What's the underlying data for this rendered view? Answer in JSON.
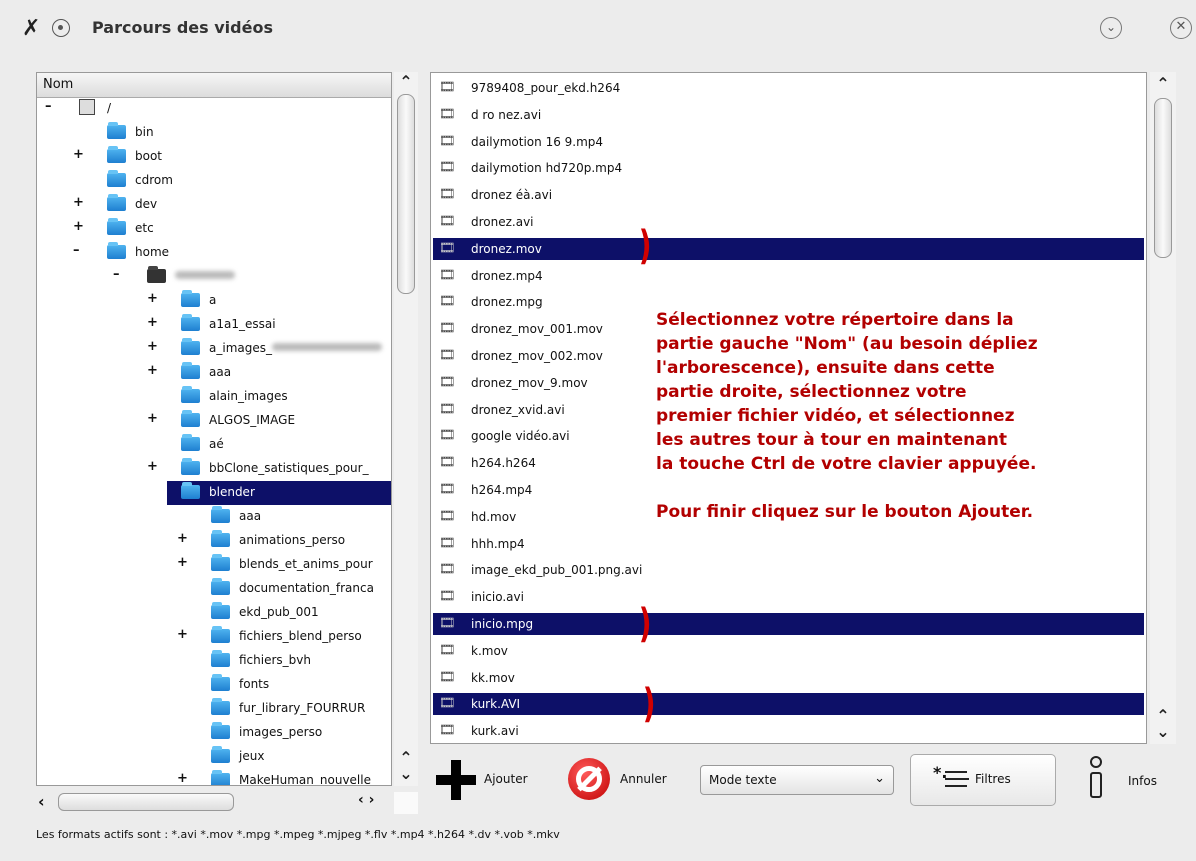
{
  "window": {
    "title": "Parcours des vidéos",
    "app_icon": "tools-icon"
  },
  "tree": {
    "header": "Nom",
    "rows": [
      {
        "label": "/",
        "type": "drive",
        "exp": "-",
        "indent": 0
      },
      {
        "label": "bin",
        "exp": "",
        "indent": 1
      },
      {
        "label": "boot",
        "exp": "+",
        "indent": 1
      },
      {
        "label": "cdrom",
        "exp": "",
        "indent": 1
      },
      {
        "label": "dev",
        "exp": "+",
        "indent": 1
      },
      {
        "label": "etc",
        "exp": "+",
        "indent": 1
      },
      {
        "label": "home",
        "exp": "-",
        "indent": 1
      },
      {
        "label": "",
        "type": "dark",
        "exp": "-",
        "indent": 2,
        "blur": 60
      },
      {
        "label": "a",
        "exp": "+",
        "indent": 3
      },
      {
        "label": "a1a1_essai",
        "exp": "+",
        "indent": 3
      },
      {
        "label": "a_images_",
        "exp": "+",
        "indent": 3,
        "blur": 110
      },
      {
        "label": "aaa",
        "exp": "+",
        "indent": 3
      },
      {
        "label": "alain_images",
        "exp": "",
        "indent": 3
      },
      {
        "label": "ALGOS_IMAGE",
        "exp": "+",
        "indent": 3
      },
      {
        "label": "aé",
        "exp": "",
        "indent": 3
      },
      {
        "label": "bbClone_satistiques_pour_",
        "exp": "+",
        "indent": 3
      },
      {
        "label": "blender",
        "exp": "-",
        "indent": 3,
        "selected": true
      },
      {
        "label": "aaa",
        "exp": "",
        "indent": 4
      },
      {
        "label": "animations_perso",
        "exp": "+",
        "indent": 4
      },
      {
        "label": "blends_et_anims_pour",
        "exp": "+",
        "indent": 4
      },
      {
        "label": "documentation_franca",
        "exp": "",
        "indent": 4
      },
      {
        "label": "ekd_pub_001",
        "exp": "",
        "indent": 4
      },
      {
        "label": "fichiers_blend_perso",
        "exp": "+",
        "indent": 4
      },
      {
        "label": "fichiers_bvh",
        "exp": "",
        "indent": 4
      },
      {
        "label": "fonts",
        "exp": "",
        "indent": 4
      },
      {
        "label": "fur_library_FOURRUR",
        "exp": "",
        "indent": 4
      },
      {
        "label": "images_perso",
        "exp": "",
        "indent": 4
      },
      {
        "label": "jeux",
        "exp": "",
        "indent": 4
      },
      {
        "label": "MakeHuman_nouvelle",
        "exp": "+",
        "indent": 4
      }
    ]
  },
  "files": [
    {
      "name": "9789408_pour_ekd.h264"
    },
    {
      "name": "d ro nez.avi"
    },
    {
      "name": "dailymotion 16 9.mp4"
    },
    {
      "name": "dailymotion hd720p.mp4"
    },
    {
      "name": "dronez éà.avi"
    },
    {
      "name": "dronez.avi"
    },
    {
      "name": "dronez.mov",
      "selected": true
    },
    {
      "name": "dronez.mp4"
    },
    {
      "name": "dronez.mpg"
    },
    {
      "name": "dronez_mov_001.mov"
    },
    {
      "name": "dronez_mov_002.mov"
    },
    {
      "name": "dronez_mov_9.mov"
    },
    {
      "name": "dronez_xvid.avi"
    },
    {
      "name": "google vidéo.avi"
    },
    {
      "name": "h264.h264"
    },
    {
      "name": "h264.mp4"
    },
    {
      "name": "hd.mov"
    },
    {
      "name": "hhh.mp4"
    },
    {
      "name": "image_ekd_pub_001.png.avi"
    },
    {
      "name": "inicio.avi"
    },
    {
      "name": "inicio.mpg",
      "selected": true
    },
    {
      "name": "k.mov"
    },
    {
      "name": "kk.mov"
    },
    {
      "name": "kurk.AVI",
      "selected": true
    },
    {
      "name": "kurk.avi"
    }
  ],
  "instructions": {
    "lines": [
      "Sélectionnez votre répertoire dans la",
      "partie gauche \"Nom\" (au besoin dépliez",
      "l'arborescence), ensuite dans cette",
      "partie droite, sélectionnez votre",
      "premier fichier vidéo, et sélectionnez",
      "les autres tour à tour en maintenant",
      "la touche Ctrl de votre clavier appuyée.",
      "",
      "Pour finir cliquez sur le bouton Ajouter."
    ],
    "color": "#b20000"
  },
  "controls": {
    "add_label": "Ajouter",
    "cancel_label": "Annuler",
    "mode_value": "Mode texte",
    "filters_label": "Filtres",
    "info_label": "Infos"
  },
  "status": "Les formats actifs sont : *.avi *.mov *.mpg *.mpeg *.mjpeg *.flv *.mp4 *.h264 *.dv *.vob *.mkv",
  "colors": {
    "selection": "#0d1068",
    "bracket": "#d00000"
  }
}
